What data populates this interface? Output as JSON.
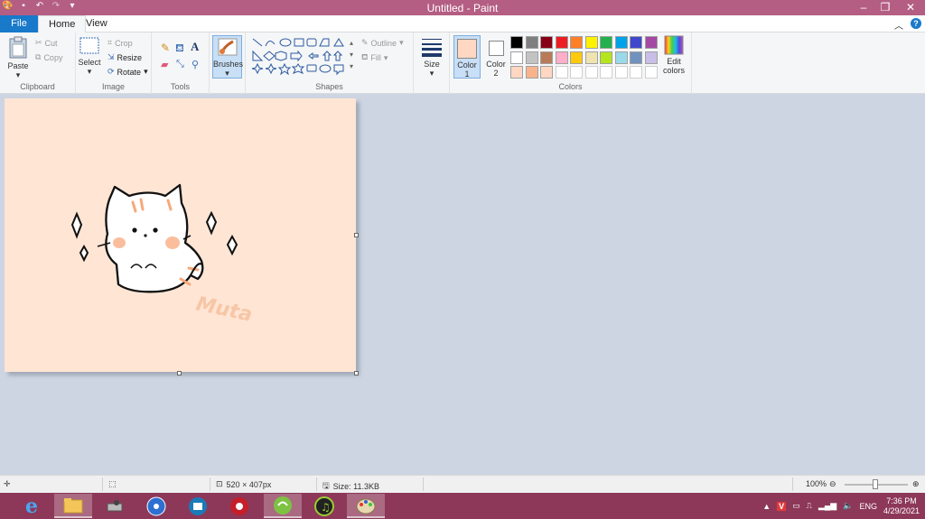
{
  "window": {
    "title": "Untitled - Paint",
    "minimize": "–",
    "maximize": "❐",
    "close": "✕"
  },
  "tabs": {
    "file": "File",
    "home": "Home",
    "view": "View"
  },
  "clipboard": {
    "paste": "Paste",
    "cut": "Cut",
    "copy": "Copy",
    "label": "Clipboard"
  },
  "image": {
    "select": "Select",
    "crop": "Crop",
    "resize": "Resize",
    "rotate": "Rotate",
    "label": "Image"
  },
  "tools": {
    "label": "Tools"
  },
  "brushes": {
    "label": "Brushes"
  },
  "shapes": {
    "outline": "Outline",
    "fill": "Fill",
    "label": "Shapes"
  },
  "size": {
    "label": "Size"
  },
  "colors": {
    "color1": "Color",
    "color1_num": "1",
    "color2": "Color",
    "color2_num": "2",
    "edit": "Edit",
    "edit2": "colors",
    "label": "Colors",
    "color1_value": "#ffd7c2",
    "color2_value": "#ffffff",
    "palette_row1": [
      "#000000",
      "#7f7f7f",
      "#880015",
      "#ed1c24",
      "#ff7f27",
      "#fff200",
      "#22b14c",
      "#00a2e8",
      "#3f48cc",
      "#a349a4"
    ],
    "palette_row2": [
      "#ffffff",
      "#c3c3c3",
      "#b97a57",
      "#ffaec9",
      "#ffc90e",
      "#efe4b0",
      "#b5e61d",
      "#99d9ea",
      "#7092be",
      "#c8bfe7"
    ],
    "palette_row3": [
      "#ffd7c2",
      "#f9b38c",
      "#ffd7c2",
      "#ffffff",
      "#ffffff",
      "#ffffff",
      "#ffffff",
      "#ffffff",
      "#ffffff",
      "#ffffff"
    ]
  },
  "canvas": {
    "color": "#ffe5d4",
    "signature": "Muta"
  },
  "status": {
    "dimensions": "520 × 407px",
    "size": "Size: 11.3KB",
    "zoom": "100%"
  },
  "tray": {
    "lang": "ENG",
    "time": "7:36 PM",
    "date": "4/29/2021"
  }
}
